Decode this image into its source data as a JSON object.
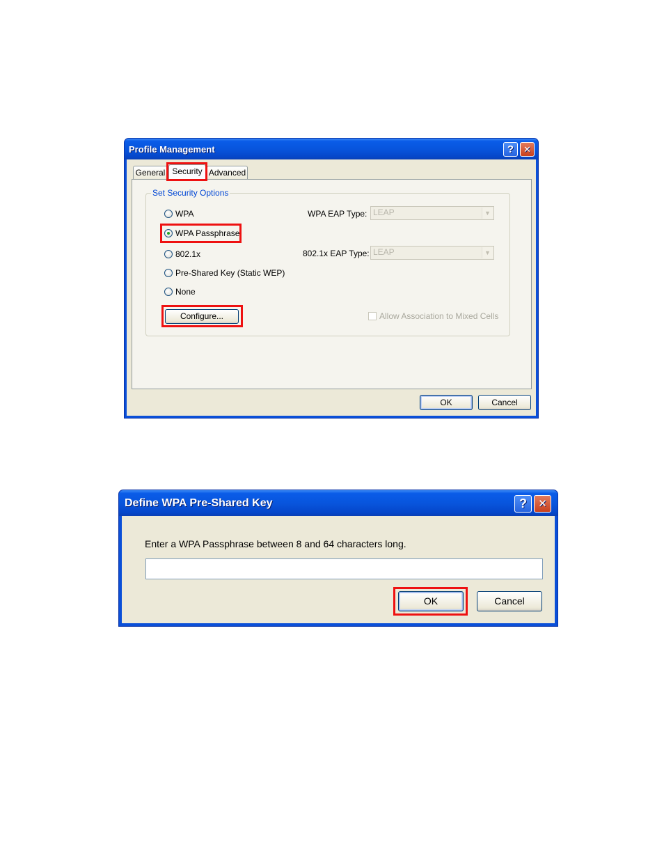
{
  "profile_dialog": {
    "title": "Profile Management",
    "help_icon": "help-icon",
    "close_icon": "close-icon",
    "tabs": [
      {
        "label": "General",
        "active": false
      },
      {
        "label": "Security",
        "active": true
      },
      {
        "label": "Advanced",
        "active": false
      }
    ],
    "group_label": "Set Security Options",
    "options": [
      {
        "label": "WPA",
        "checked": false
      },
      {
        "label": "WPA Passphrase",
        "checked": true
      },
      {
        "label": "802.1x",
        "checked": false
      },
      {
        "label": "Pre-Shared Key (Static WEP)",
        "checked": false
      },
      {
        "label": "None",
        "checked": false
      }
    ],
    "wpa_eap_type_label": "WPA EAP Type:",
    "wpa_eap_type_value": "LEAP",
    "dot1x_eap_type_label": "802.1x EAP Type:",
    "dot1x_eap_type_value": "LEAP",
    "configure_label": "Configure...",
    "allow_mixed_cells_label": "Allow Association to Mixed Cells",
    "allow_mixed_cells_checked": false,
    "ok_label": "OK",
    "cancel_label": "Cancel"
  },
  "psk_dialog": {
    "title": "Define WPA Pre-Shared Key",
    "help_icon": "help-icon",
    "close_icon": "close-icon",
    "prompt": "Enter a WPA Passphrase between 8 and 64 characters long.",
    "passphrase_value": "",
    "ok_label": "OK",
    "cancel_label": "Cancel"
  },
  "glyphs": {
    "help": "?",
    "close": "✕",
    "dropdown": "▼"
  },
  "colors": {
    "highlight": "#ee1111",
    "titlebar": "#0855dd",
    "dialog_bg": "#ece9d8"
  }
}
